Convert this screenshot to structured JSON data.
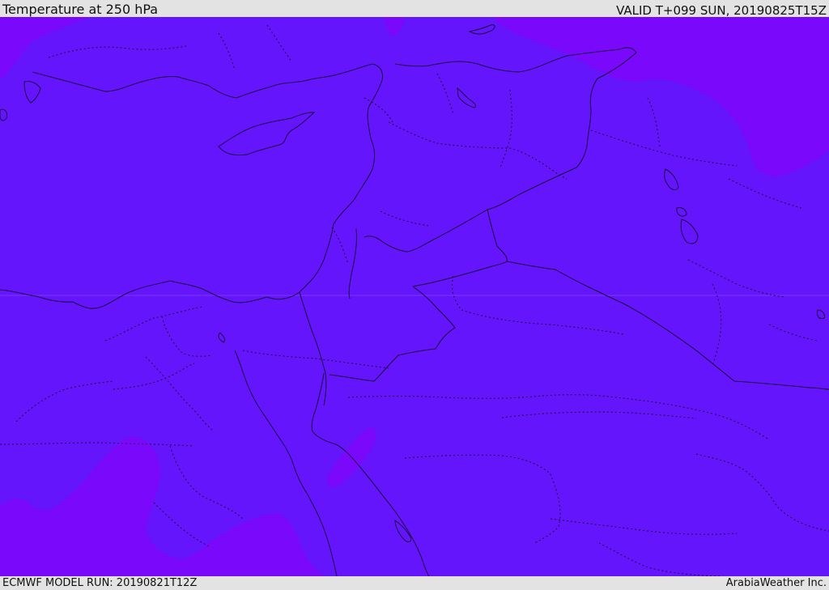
{
  "header": {
    "title": "Temperature at 250 hPa",
    "valid": "VALID T+099 SUN, 20190825T15Z"
  },
  "footer": {
    "model_run": "ECMWF MODEL RUN: 20190821T12Z",
    "credit": "ArabiaWeather Inc."
  },
  "map": {
    "field": "temperature-250hpa",
    "colors": {
      "main_band": "#6515fb",
      "cold_band": "#7a08fb",
      "coastline": "#1c0a44"
    }
  }
}
